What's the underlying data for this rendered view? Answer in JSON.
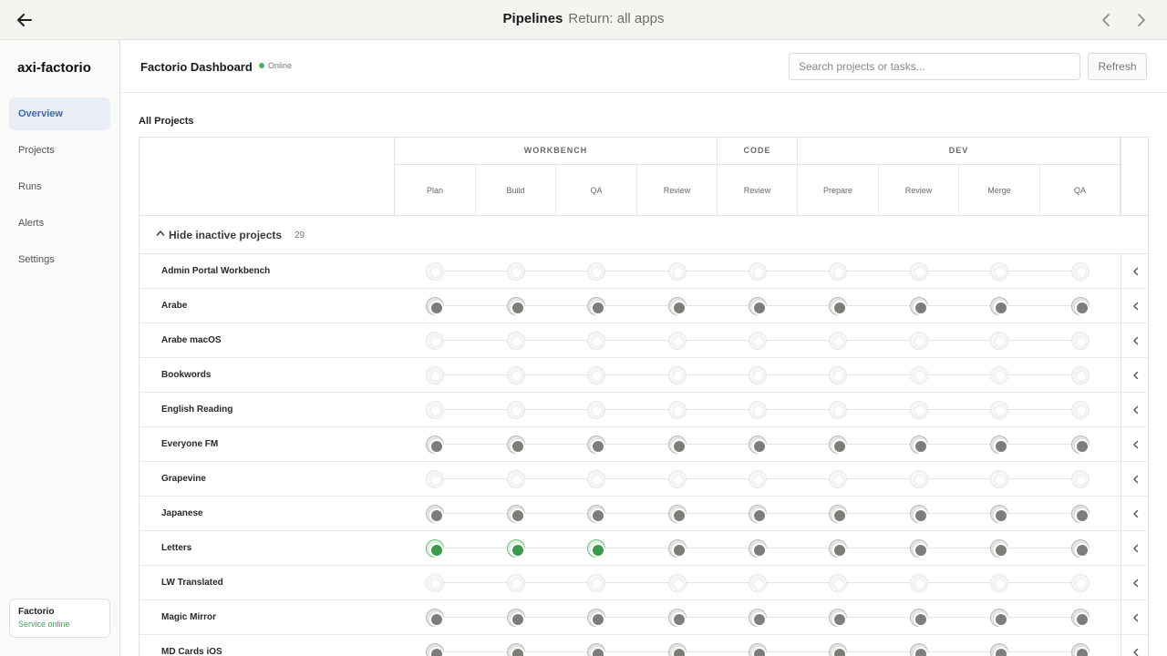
{
  "topbar": {
    "title": "Pipelines",
    "subtitle": "Return: all apps",
    "back_icon": "arrow-left-icon",
    "prev_icon": "chevron-left-icon",
    "next_icon": "chevron-right-icon"
  },
  "sidebar": {
    "brand": "axi-factorio",
    "items": [
      {
        "label": "Overview",
        "active": true
      },
      {
        "label": "Projects",
        "active": false
      },
      {
        "label": "Runs",
        "active": false
      },
      {
        "label": "Alerts",
        "active": false
      },
      {
        "label": "Settings",
        "active": false
      }
    ],
    "status": {
      "name": "Factorio",
      "state": "Service online"
    }
  },
  "header": {
    "title": "Factorio Dashboard",
    "status": "Online",
    "search_placeholder": "Search projects or tasks...",
    "refresh_label": "Refresh"
  },
  "section_title": "All Projects",
  "groups": [
    {
      "name": "WORKBENCH",
      "span": 4
    },
    {
      "name": "CODE",
      "span": 1
    },
    {
      "name": "DEV",
      "span": 4
    }
  ],
  "stages": [
    "Plan",
    "Build",
    "QA",
    "Review",
    "Review",
    "Prepare",
    "Review",
    "Merge",
    "QA"
  ],
  "toggle": {
    "label": "Hide inactive projects",
    "count": "29"
  },
  "projects": [
    {
      "name": "Admin Portal Workbench",
      "states": [
        "inactive",
        "inactive",
        "inactive",
        "inactive",
        "inactive",
        "inactive",
        "inactive",
        "inactive",
        "inactive"
      ]
    },
    {
      "name": "Arabe",
      "states": [
        "pending",
        "pending",
        "pending",
        "pending",
        "pending",
        "pending",
        "pending",
        "pending",
        "pending"
      ]
    },
    {
      "name": "Arabe macOS",
      "states": [
        "inactive",
        "inactive",
        "inactive",
        "inactive",
        "inactive",
        "inactive",
        "inactive",
        "inactive",
        "inactive"
      ]
    },
    {
      "name": "Bookwords",
      "states": [
        "inactive",
        "inactive",
        "inactive",
        "inactive",
        "inactive",
        "inactive",
        "inactive",
        "inactive",
        "inactive"
      ]
    },
    {
      "name": "English Reading",
      "states": [
        "inactive",
        "inactive",
        "inactive",
        "inactive",
        "inactive",
        "inactive",
        "inactive",
        "inactive",
        "inactive"
      ]
    },
    {
      "name": "Everyone FM",
      "states": [
        "pending",
        "pending",
        "pending",
        "pending",
        "pending",
        "pending",
        "pending",
        "pending",
        "pending"
      ]
    },
    {
      "name": "Grapevine",
      "states": [
        "inactive",
        "inactive",
        "inactive",
        "inactive",
        "inactive",
        "inactive",
        "inactive",
        "inactive",
        "inactive"
      ]
    },
    {
      "name": "Japanese",
      "states": [
        "pending",
        "pending",
        "pending",
        "pending",
        "pending",
        "pending",
        "pending",
        "pending",
        "pending"
      ]
    },
    {
      "name": "Letters",
      "states": [
        "done",
        "done",
        "done",
        "pending",
        "pending",
        "pending",
        "pending",
        "pending",
        "pending"
      ]
    },
    {
      "name": "LW Translated",
      "states": [
        "inactive",
        "inactive",
        "inactive",
        "inactive",
        "inactive",
        "inactive",
        "inactive",
        "inactive",
        "inactive"
      ]
    },
    {
      "name": "Magic Mirror",
      "states": [
        "pending",
        "pending",
        "pending",
        "pending",
        "pending",
        "pending",
        "pending",
        "pending",
        "pending"
      ]
    },
    {
      "name": "MD Cards iOS",
      "states": [
        "pending",
        "pending",
        "pending",
        "pending",
        "pending",
        "pending",
        "pending",
        "pending",
        "pending"
      ]
    }
  ]
}
